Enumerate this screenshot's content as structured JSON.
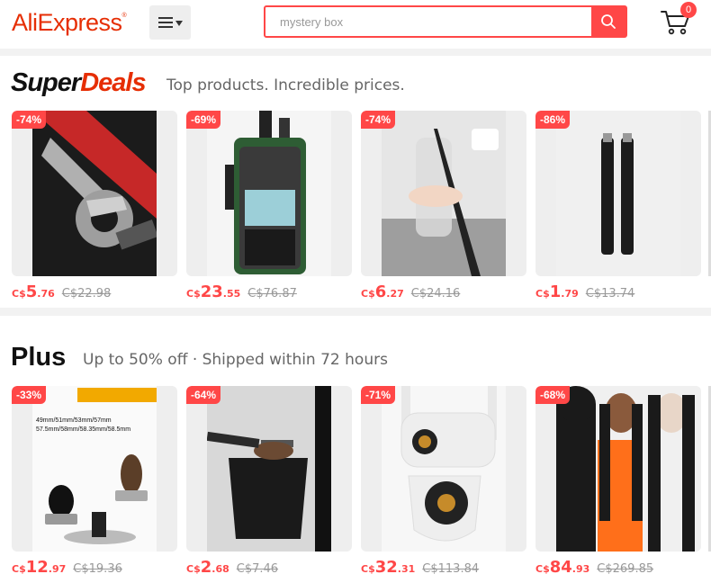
{
  "header": {
    "logo_text": "AliExpress",
    "search_placeholder": "mystery box",
    "cart_count": "0",
    "menu_icon": "hamburger-icon",
    "search_icon": "search-icon",
    "cart_icon": "cart-icon"
  },
  "super_deals": {
    "title_part1": "Super",
    "title_part2": "Deals",
    "subtitle": "Top products. Incredible prices.",
    "products": [
      {
        "discount": "-74%",
        "currency": "C$",
        "price_int": "5",
        "price_dec": ".76",
        "old_price": "C$22.98"
      },
      {
        "discount": "-69%",
        "currency": "C$",
        "price_int": "23",
        "price_dec": ".55",
        "old_price": "C$76.87"
      },
      {
        "discount": "-74%",
        "currency": "C$",
        "price_int": "6",
        "price_dec": ".27",
        "old_price": "C$24.16"
      },
      {
        "discount": "-86%",
        "currency": "C$",
        "price_int": "1",
        "price_dec": ".79",
        "old_price": "C$13.74"
      }
    ]
  },
  "plus": {
    "title": "Plus",
    "subtitle": "Up to 50% off · Shipped within 72 hours",
    "products": [
      {
        "discount": "-33%",
        "currency": "C$",
        "price_int": "12",
        "price_dec": ".97",
        "old_price": "C$19.36",
        "image_text_1": "49mm/51mm/53mm/57mm",
        "image_text_2": "57.5mm/58mm/58.35mm/58.5mm"
      },
      {
        "discount": "-64%",
        "currency": "C$",
        "price_int": "2",
        "price_dec": ".68",
        "old_price": "C$7.46"
      },
      {
        "discount": "-71%",
        "currency": "C$",
        "price_int": "32",
        "price_dec": ".31",
        "old_price": "C$113.84"
      },
      {
        "discount": "-68%",
        "currency": "C$",
        "price_int": "84",
        "price_dec": ".93",
        "old_price": "C$269.85"
      }
    ]
  },
  "colors": {
    "brand": "#e62e04",
    "accent": "#ff4747",
    "muted": "#999999"
  }
}
